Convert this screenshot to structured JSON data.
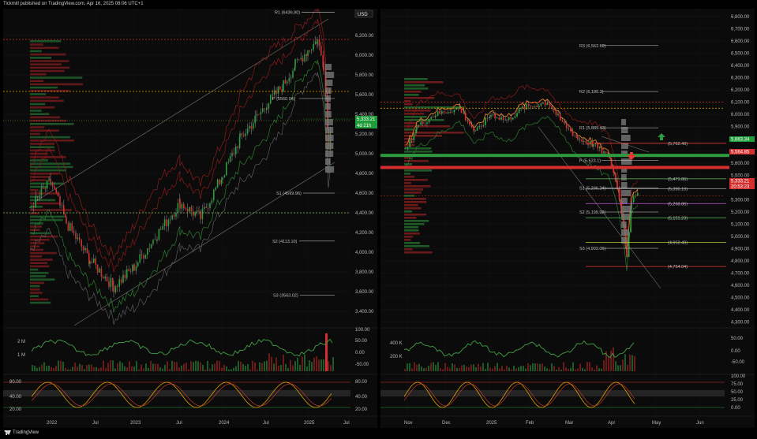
{
  "header": {
    "title": "Tickmill published on TradingView.com, Apr 16, 2025 08:06 UTC+1"
  },
  "footer": {
    "brand": "TradingView"
  },
  "colors": {
    "up": "#2e9c3e",
    "down": "#d32f2f",
    "background": "#0b0b0b",
    "price_tag": "#d32f2f",
    "countdown_tag": "#1f9d3a"
  },
  "left_chart": {
    "currency_badge": "USD",
    "price_tag": "5,333.21",
    "countdown_tag": "4d 21h",
    "price_ticks": [
      "6,200.00",
      "6,000.00",
      "5,800.00",
      "5,600.00",
      "5,400.00",
      "5,200.00",
      "5,000.00",
      "4,800.00",
      "4,600.00",
      "4,400.00",
      "4,200.00",
      "4,000.00",
      "3,800.00",
      "3,600.00",
      "3,400.00"
    ],
    "time_ticks": [
      "2022",
      "Jul",
      "2023",
      "Jul",
      "2024",
      "Jul",
      "2025",
      "Jul"
    ],
    "pivot_labels": [
      "R1 (6436.80)",
      "P (5560.04)",
      "S1 (4599.96)",
      "S2 (4113.10)",
      "S3 (3563.02)"
    ],
    "volume_ticks": [
      "2 M",
      "1 M"
    ],
    "volume_osc_ticks": [
      "100.00",
      "50.00",
      "0.00",
      "-50.00"
    ],
    "stoch_ticks_left": [
      "80.00",
      "40.00",
      "20.00"
    ],
    "stoch_ticks_right": [
      "80.00",
      "40.00",
      "20.00"
    ]
  },
  "right_chart": {
    "price_tag": "5,333.21",
    "countdown_tag": "20:53:23",
    "green_level_tag": "5,663.34",
    "red_level_tag": "5,564.85",
    "price_ticks": [
      "6,800.00",
      "6,700.00",
      "6,600.00",
      "6,500.00",
      "6,400.00",
      "6,300.00",
      "6,200.00",
      "6,100.00",
      "6,000.00",
      "5,900.00",
      "5,800.00",
      "5,700.00",
      "5,600.00",
      "5,500.00",
      "5,400.00",
      "5,300.00",
      "5,200.00",
      "5,100.00",
      "5,000.00",
      "4,900.00",
      "4,800.00",
      "4,700.00",
      "4,600.00",
      "4,500.00",
      "4,400.00",
      "4,300.00"
    ],
    "time_ticks": [
      "Nov",
      "Dec",
      "2025",
      "Feb",
      "Mar",
      "Apr",
      "May",
      "Jun"
    ],
    "pivot_labels": [
      "R3 (6,562.62)",
      "R2 (6,186.3)",
      "R1 (5,889.43)",
      "P (5,623.1)",
      "S1 (5,296.24)",
      "S2 (5,199.92)",
      "S3 (4,903.05)"
    ],
    "target_labels": [
      "(5,762.49)",
      "(5,471.86)",
      "(5,390.19)",
      "(5,268.86)",
      "(5,151.23)",
      "(4,952.40)",
      "(4,754.04)"
    ],
    "volume_ticks": [
      "400 K",
      "200 K"
    ],
    "volume_osc_ticks": [
      "50.00",
      "0.00",
      "-50.00"
    ],
    "stoch_ticks": [
      "100.00",
      "75.00",
      "50.00",
      "25.00",
      "0.00"
    ]
  }
}
